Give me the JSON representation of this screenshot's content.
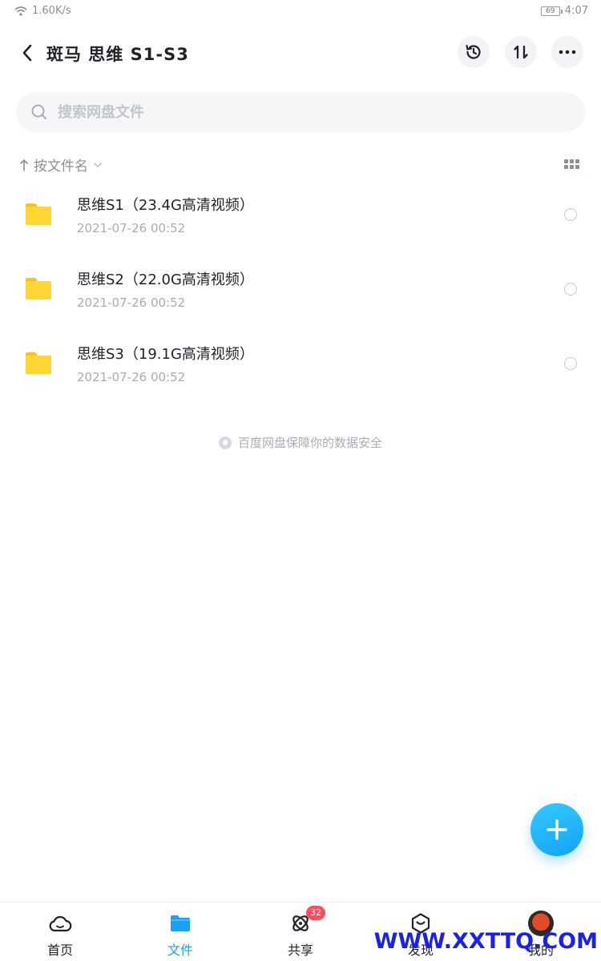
{
  "status_bar": {
    "network_speed": "1.60K/s",
    "battery": "69",
    "time": "4:07"
  },
  "header": {
    "title": "斑马 思维 S1-S3",
    "icons": [
      "back-icon",
      "history-icon",
      "sort-icon",
      "more-icon"
    ]
  },
  "search": {
    "placeholder": "搜索网盘文件"
  },
  "sort": {
    "label": "按文件名"
  },
  "files": [
    {
      "name": "思维S1（23.4G高清视频）",
      "date": "2021-07-26  00:52"
    },
    {
      "name": "思维S2（22.0G高清视频）",
      "date": "2021-07-26  00:52"
    },
    {
      "name": "思维S3（19.1G高清视频）",
      "date": "2021-07-26  00:52"
    }
  ],
  "footer_note": "百度网盘保障你的数据安全",
  "tabs": [
    {
      "label": "首页",
      "icon": "cloud-icon"
    },
    {
      "label": "文件",
      "icon": "folder-icon",
      "active": true
    },
    {
      "label": "共享",
      "icon": "share-icon",
      "badge": "32"
    },
    {
      "label": "发现",
      "icon": "discover-icon"
    },
    {
      "label": "我的",
      "icon": "avatar"
    }
  ],
  "watermark": "WWW.XXTTQ.COM",
  "colors": {
    "accent": "#1aa0f5",
    "folder": "#ffd633",
    "badge": "#ff4d5e"
  }
}
